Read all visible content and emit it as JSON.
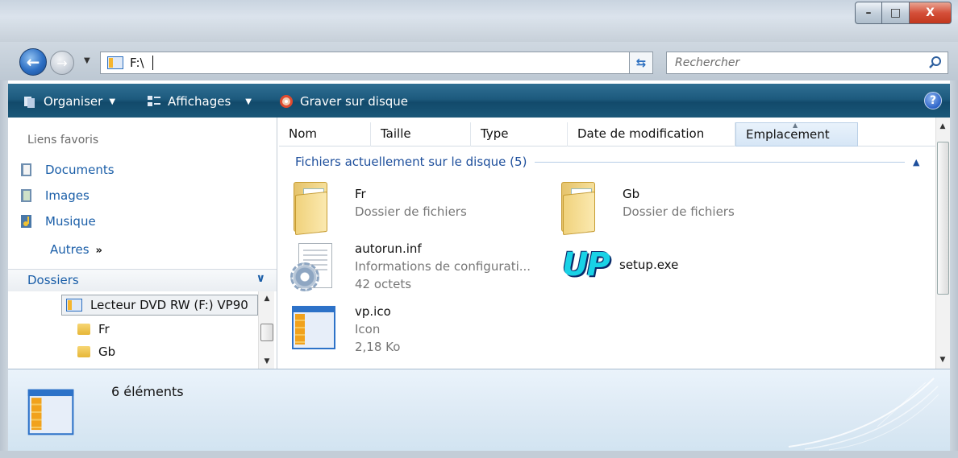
{
  "window": {
    "buttons": {
      "minimize": "–",
      "maximize": "□",
      "close": "X"
    }
  },
  "nav": {
    "address": "F:\\",
    "search_placeholder": "Rechercher"
  },
  "toolbar": {
    "organize": "Organiser",
    "views": "Affichages",
    "burn": "Graver sur disque",
    "help": "?"
  },
  "sidebar": {
    "favorites_title": "Liens favoris",
    "favorites": [
      {
        "label": "Documents",
        "icon": "documents-icon"
      },
      {
        "label": "Images",
        "icon": "images-icon"
      },
      {
        "label": "Musique",
        "icon": "music-icon"
      }
    ],
    "more_label": "Autres",
    "more_chevron": "»",
    "folders_label": "Dossiers",
    "tree": [
      {
        "label": "Lecteur DVD RW (F:) VP90",
        "selected": true
      },
      {
        "label": "Fr"
      },
      {
        "label": "Gb"
      }
    ]
  },
  "columns": [
    {
      "label": "Nom"
    },
    {
      "label": "Taille"
    },
    {
      "label": "Type"
    },
    {
      "label": "Date de modification"
    },
    {
      "label": "Emplacement",
      "sorted": true
    }
  ],
  "group": {
    "title": "Fichiers actuellement sur le disque (5)"
  },
  "files": [
    {
      "name": "Fr",
      "line2": "Dossier de fichiers",
      "line3": "",
      "icon": "folder-icon"
    },
    {
      "name": "Gb",
      "line2": "Dossier de fichiers",
      "line3": "",
      "icon": "folder-icon"
    },
    {
      "name": "autorun.inf",
      "line2": "Informations de configurati...",
      "line3": "42 octets",
      "icon": "config-file-icon"
    },
    {
      "name": "setup.exe",
      "line2": "",
      "line3": "",
      "icon": "up-setup-icon"
    },
    {
      "name": "vp.ico",
      "line2": "Icon",
      "line3": "2,18 Ko",
      "icon": "window-icon"
    }
  ],
  "details": {
    "count": "6 éléments"
  },
  "colors": {
    "accent": "#1a5ea8",
    "command_bar": "#1d5a7e",
    "close": "#c1361c"
  }
}
